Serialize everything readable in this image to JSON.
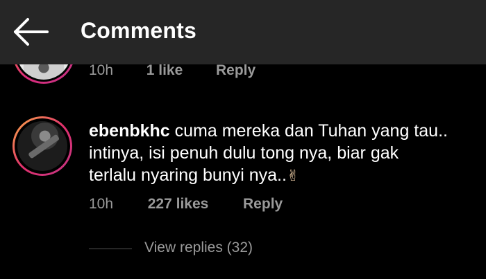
{
  "header": {
    "title": "Comments",
    "back_icon": "back-arrow-icon",
    "background": "#262626"
  },
  "previous_comment": {
    "time": "10h",
    "likes": "1 like",
    "reply": "Reply"
  },
  "comment": {
    "username": "ebenbkhc",
    "text": "cuma mereka dan Tuhan yang tau.. intinya, isi penuh dulu tong nya, biar gak terlalu nyaring bunyi nya..",
    "emoji": "✌",
    "time": "10h",
    "likes": "227 likes",
    "reply": "Reply",
    "view_replies": "View replies (32)"
  },
  "colors": {
    "background": "#000000",
    "primary_text": "#ffffff",
    "secondary_text": "#9a9a9a",
    "story_ring_start": "#fcaf45",
    "story_ring_end": "#c13584"
  }
}
